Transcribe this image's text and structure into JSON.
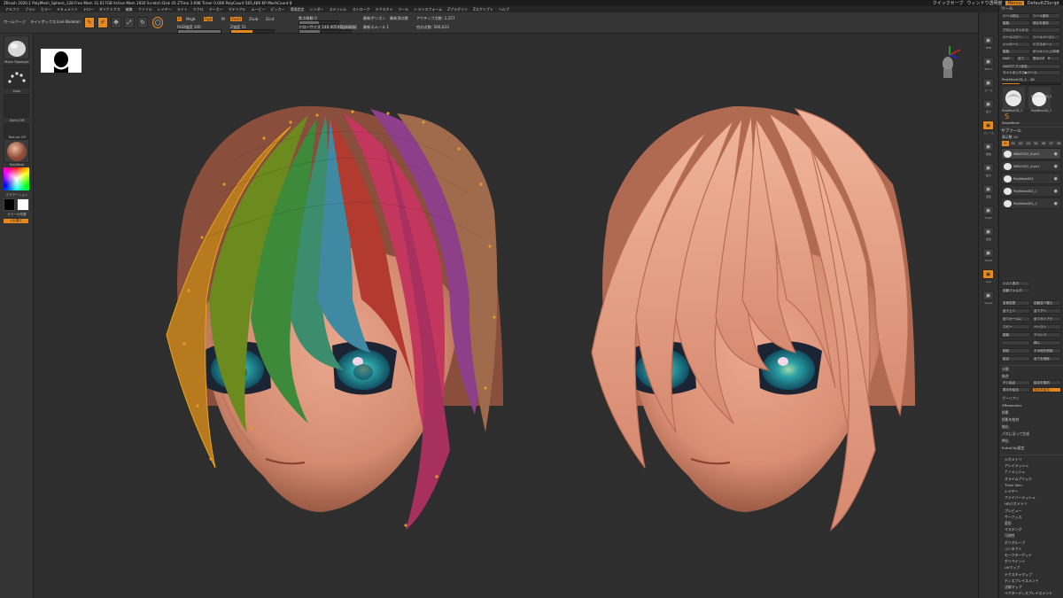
{
  "title_bar": {
    "title": "ZBrush 2020.1   PolyMesh_Sphere_128   Free Mem 31.617GB   Active Mem 1920   Scratch Disk 45   ZTime 3.698  Timer 0.006   PolyCount 565,486 KP   MeshCount 8",
    "right_items": [
      "クイックセーブ",
      "ウィンドウ透明度",
      "Menus",
      "DefaultZScript"
    ]
  },
  "menu": [
    "アルファ",
    "ブラシ",
    "カラー",
    "ドキュメント",
    "ドロー",
    "ダイナミクス",
    "編集",
    "ファイル",
    "レイヤー",
    "ライト",
    "マクロ",
    "マーカー",
    "マテリアル",
    "ムービー",
    "ピッカー",
    "環境設定",
    "レンダー",
    "ステンシル",
    "ストローク",
    "テクスチャ",
    "ツール",
    "トランスフォーム",
    "Zプラグイン",
    "Zスクリプト",
    "ヘルプ"
  ],
  "toolbar": {
    "home_label": "ホームページ",
    "lightbox_label": "ライトボックス",
    "livebool_label": "Live Boolean",
    "edit_label": "Edit",
    "draw_label": "Draw",
    "move_label": "Move",
    "scale_label": "Scale",
    "rotate_label": "Rotate",
    "mrgb_label": "Mrgb",
    "rgb_label": "Rgb",
    "m_label": "M",
    "zadd_label": "Zadd",
    "zsub_label": "Zsub",
    "zcut_label": "Zcut",
    "rgb_intensity": "RGB強度 100",
    "z_intensity": "Z強度 51",
    "focal_shift": "焦点移動 0",
    "draw_size": "ドローサイズ 140.40594",
    "dynamic_label": "Dynamic",
    "active_points": "アクティブ点数: 1,257",
    "total_points": "合計点数: 566,623",
    "pref_1": "最新ポリゴン",
    "pref_2": "最新頂点数",
    "smooth_label": "最新スムース 1"
  },
  "left_shelf": {
    "brush_name": "Move Topologic",
    "stroke_name": "Dots",
    "alpha_name": "Alpha Off",
    "texture_name": "Texture Off",
    "material_name": "PolyMesh",
    "gradient_label": "グラデーション",
    "swap_label": "カラーの切替",
    "fill_label": "入れ替え"
  },
  "palette": {
    "header": "ツール",
    "buttons_top": [
      [
        "ツール読込",
        "ツール保存"
      ],
      [
        "複製",
        "読込を保存"
      ],
      [
        "プロジェクトからツール読込",
        ""
      ],
      [
        "ツールコピー",
        "ツールペースト"
      ],
      [
        "インポート",
        "エクスポート"
      ],
      [
        "複製",
        "ポリメッシュ3D化"
      ],
      [
        "GoZ",
        "全て",
        "表示のみ",
        "R"
      ]
    ],
    "goz_plugin": "GoZ3アプリ設定...",
    "lightbox_tools": "ライトボックス▶ツール",
    "current_tool": "PolyMesh3D_1 . 48",
    "tool_thumbs": [
      "PolyMesh3D_1",
      "PolyMesh3D_2",
      "SimpleBrush",
      "PolyMesh3D_1"
    ],
    "subtool_header": "サブツール",
    "visible_count": "表示数 10",
    "subtool_tabs": [
      "V1",
      "V2",
      "V3",
      "V4",
      "V5",
      "V6",
      "V7",
      "V8"
    ],
    "subtools": [
      "MIKU2022_CLp01",
      "MIKU2022_CLp01",
      "PolyMesh003",
      "PolyMesh3D1_1",
      "PolyMesh3D1_2"
    ],
    "list_all": "リスト表示",
    "auto_collapse": "自動フォルダ",
    "mid_buttons": [
      [
        "名前変更",
        "自動並べ替え"
      ],
      [
        "全て上へ",
        "全て下へ"
      ],
      [
        "全てオールに",
        "全てガイアナ"
      ],
      [
        "コピー",
        "ペースト"
      ],
      [
        "複製",
        "アペンド"
      ],
      [
        "",
        "挿入"
      ],
      [
        "削除",
        "その他を削除"
      ],
      [
        "結合",
        "全てを削除"
      ]
    ],
    "split_header": "分割",
    "merge_label": "結合",
    "merge_opts": [
      "下と結合",
      "結合を集約"
    ],
    "boolean_row": [
      "表示を結合",
      "頂点を結合"
    ],
    "sections": [
      "ブーリアン",
      "ZRemesher",
      "投影",
      "投影を結合",
      "抽出",
      "パスに沿って生成",
      "押出",
      "ExtraClip設定"
    ],
    "sub_sections": [
      "ジオメトリ",
      "アレイメッシュ",
      "ナノメッシュ",
      "スライムブリッジ",
      "Thick Skin",
      "レイヤー",
      "ファイバーメッシュ",
      "HDジオメトリ",
      "プレビュー",
      "サーフェス",
      "変形",
      "マスキング",
      "可視性",
      "ポリグループ",
      "コンタクト",
      "モーフターゲット",
      "ポリペイント",
      "UVマップ",
      "テクスチャマップ",
      "ディスプレイスメント",
      "法線マップ",
      "ベクターディスプレイスメント"
    ]
  },
  "right_icons": [
    "BPR",
    "SPix 3",
    "ズーム",
    "実寸",
    "フレーム",
    "移動",
    "拡大",
    "回転",
    "PolyF",
    "透過",
    "Ghost",
    "Solo",
    "Xpose"
  ],
  "colors": {
    "accent": "#e58a1f",
    "skin": "#e29f86",
    "hair_right": "#eaa68a",
    "iris": "#2fa0a7"
  }
}
